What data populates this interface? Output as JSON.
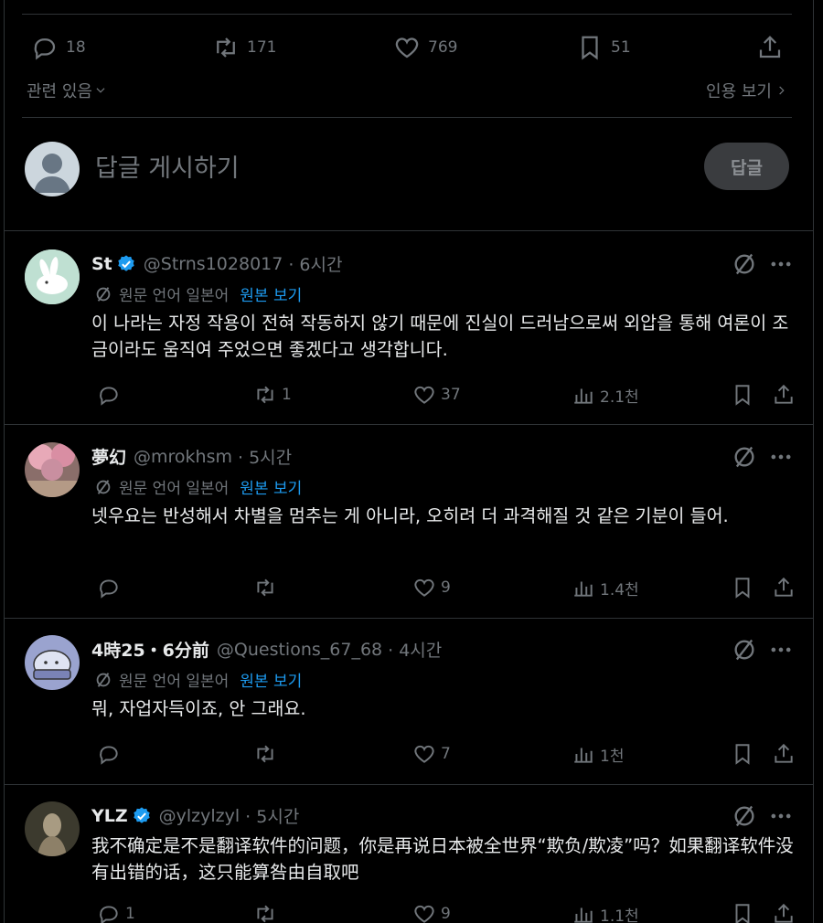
{
  "main_tweet": {
    "stats": {
      "replies": "18",
      "reposts": "171",
      "likes": "769",
      "bookmarks": "51"
    },
    "related_label": "관련 있음",
    "quotes_label": "인용 보기"
  },
  "compose": {
    "placeholder": "답글 게시하기",
    "button": "답글"
  },
  "translation": {
    "source_label": "원문 언어 일본어",
    "view_original": "원본 보기"
  },
  "replies": [
    {
      "name": "St",
      "verified": true,
      "handle": "@Strns1028017",
      "time": "· 6시간",
      "translated": true,
      "text": "이 나라는 자정 작용이 전혀 작동하지 않기 때문에 진실이 드러남으로써 외압을 통해 여론이 조금이라도 움직여 주었으면 좋겠다고 생각합니다.",
      "replies": "",
      "reposts": "1",
      "likes": "37",
      "views": "2.1천"
    },
    {
      "name": "夢幻",
      "verified": false,
      "handle": "@mrokhsm",
      "time": "· 5시간",
      "translated": true,
      "text": "넷우요는 반성해서 차별을 멈추는 게 아니라, 오히려 더 과격해질 것 같은 기분이 들어.",
      "replies": "",
      "reposts": "",
      "likes": "9",
      "views": "1.4천"
    },
    {
      "name": "4時25・6分前",
      "verified": false,
      "handle": "@Questions_67_68",
      "time": "· 4시간",
      "translated": true,
      "text": "뭐, 자업자득이죠, 안 그래요.",
      "replies": "",
      "reposts": "",
      "likes": "7",
      "views": "1천"
    },
    {
      "name": "YLZ",
      "verified": true,
      "handle": "@ylzylzyl",
      "time": "· 5시간",
      "translated": false,
      "text": "我不确定是不是翻译软件的问题，你是再说日本被全世界“欺负/欺凌”吗？如果翻译软件没有出错的话，这只能算咎由自取吧",
      "replies": "1",
      "reposts": "",
      "likes": "9",
      "views": "1.1천"
    }
  ],
  "colors": {
    "background": "#000000",
    "text": "#e7e9ea",
    "muted": "#71767b",
    "accent": "#1d9bf0",
    "divider": "#2f3336"
  }
}
